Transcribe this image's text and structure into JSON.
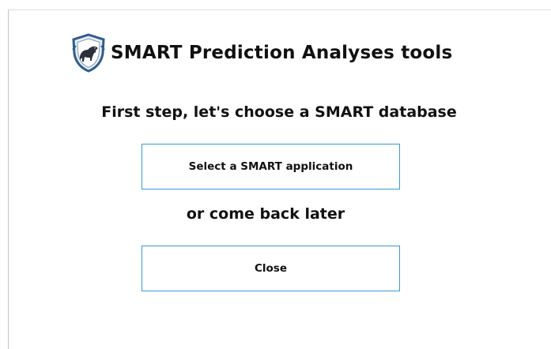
{
  "app": {
    "title": "SMART Prediction Analyses tools",
    "logo_icon": "shield-panther-icon"
  },
  "main": {
    "step_heading": "First step, let's choose a SMART database",
    "select_button_label": "Select a SMART application",
    "or_text": "or come back later",
    "close_button_label": "Close"
  },
  "colors": {
    "button_border": "#3a9ad9",
    "shield_blue": "#2f5d8c",
    "text": "#111111"
  }
}
